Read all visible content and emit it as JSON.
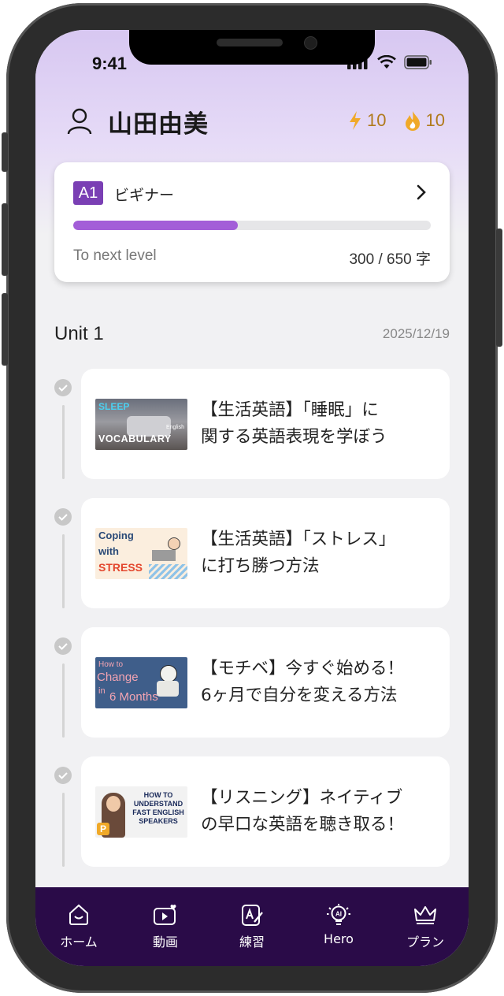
{
  "status_bar": {
    "time": "9:41"
  },
  "header": {
    "user_name": "山田由美",
    "xp": "10",
    "streak": "10"
  },
  "level": {
    "badge": "A1",
    "name": "ビギナー",
    "progress_label": "To next level",
    "progress_count": "300 / 650 字",
    "progress_fraction": 0.46
  },
  "unit": {
    "title": "Unit 1",
    "date": "2025/12/19"
  },
  "lessons": [
    {
      "line1": "【生活英語】「睡眠」に",
      "line2": "関する英語表現を学ぼう",
      "thumb": {
        "top": "SLEEP",
        "bottom": "VOCABULARY",
        "small": "English"
      }
    },
    {
      "line1": "【生活英語】「ストレス」",
      "line2": "に打ち勝つ方法",
      "thumb": {
        "l1": "Coping",
        "l2": "with",
        "l3": "STRESS"
      }
    },
    {
      "line1": "【モチベ】今すぐ始める！",
      "line2": "6ヶ月で自分を変える方法",
      "thumb": {
        "l1": "How to",
        "l2": "Change",
        "l3": "in",
        "l4": "6 Months"
      }
    },
    {
      "line1": "【リスニング】ネイティブ",
      "line2": "の早口な英語を聴き取る！",
      "thumb": {
        "text": "HOW TO UNDERSTAND FAST ENGLISH SPEAKERS",
        "badge": "P"
      }
    }
  ],
  "tabs": [
    {
      "label": "ホーム",
      "icon": "home-icon"
    },
    {
      "label": "動画",
      "icon": "video-icon"
    },
    {
      "label": "練習",
      "icon": "practice-icon"
    },
    {
      "label": "Hero",
      "icon": "ai-bulb-icon"
    },
    {
      "label": "プラン",
      "icon": "crown-icon"
    }
  ],
  "colors": {
    "accent": "#7a3fb4",
    "progress": "#a35ed8",
    "tabbar": "#2a0b48",
    "stat": "#b07a1c"
  }
}
